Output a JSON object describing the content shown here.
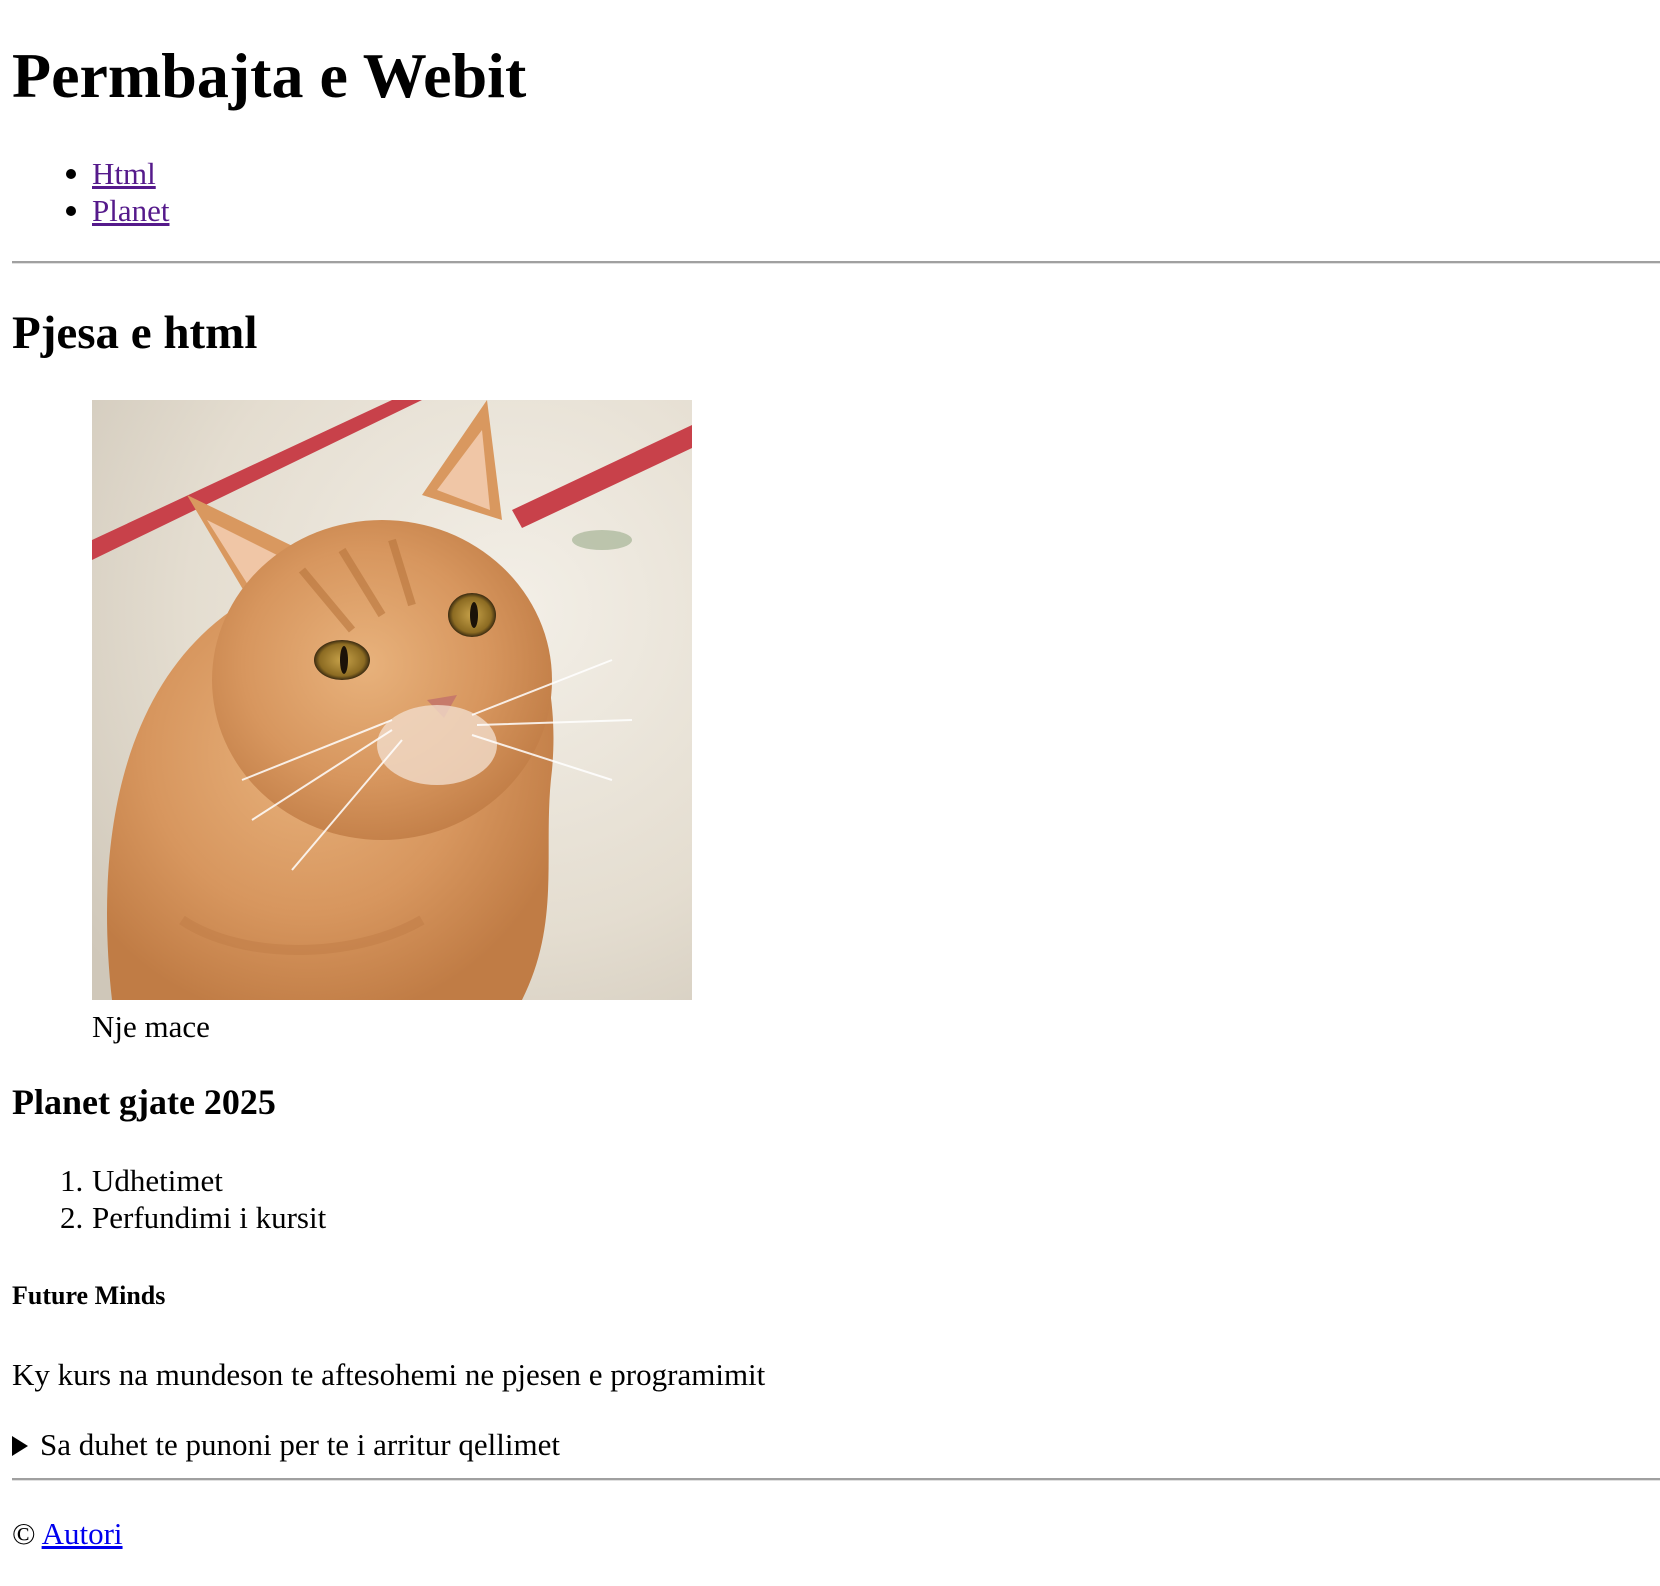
{
  "page": {
    "title": "Permbajta e Webit"
  },
  "nav": {
    "items": [
      {
        "label": "Html"
      },
      {
        "label": "Planet"
      }
    ]
  },
  "html_section": {
    "heading": "Pjesa e html",
    "figure": {
      "image_icon": "cat-photo",
      "caption": "Nje mace"
    }
  },
  "plans": {
    "heading": "Planet gjate 2025",
    "items": [
      {
        "number": "1.",
        "label": "Udhetimet"
      },
      {
        "number": "2.",
        "label": "Perfundimi i kursit"
      }
    ]
  },
  "about": {
    "heading": "Future Minds",
    "text": "Ky kurs na mundeson te aftesohemi ne pjesen e programimit",
    "details_summary": "Sa duhet te punoni per te i arritur qellimet"
  },
  "footer": {
    "copyright_symbol": "©",
    "author_link": "Autori"
  },
  "colors": {
    "visited_link": "#551a8b",
    "link": "#0000ee",
    "rule": "#a0a0a0"
  }
}
